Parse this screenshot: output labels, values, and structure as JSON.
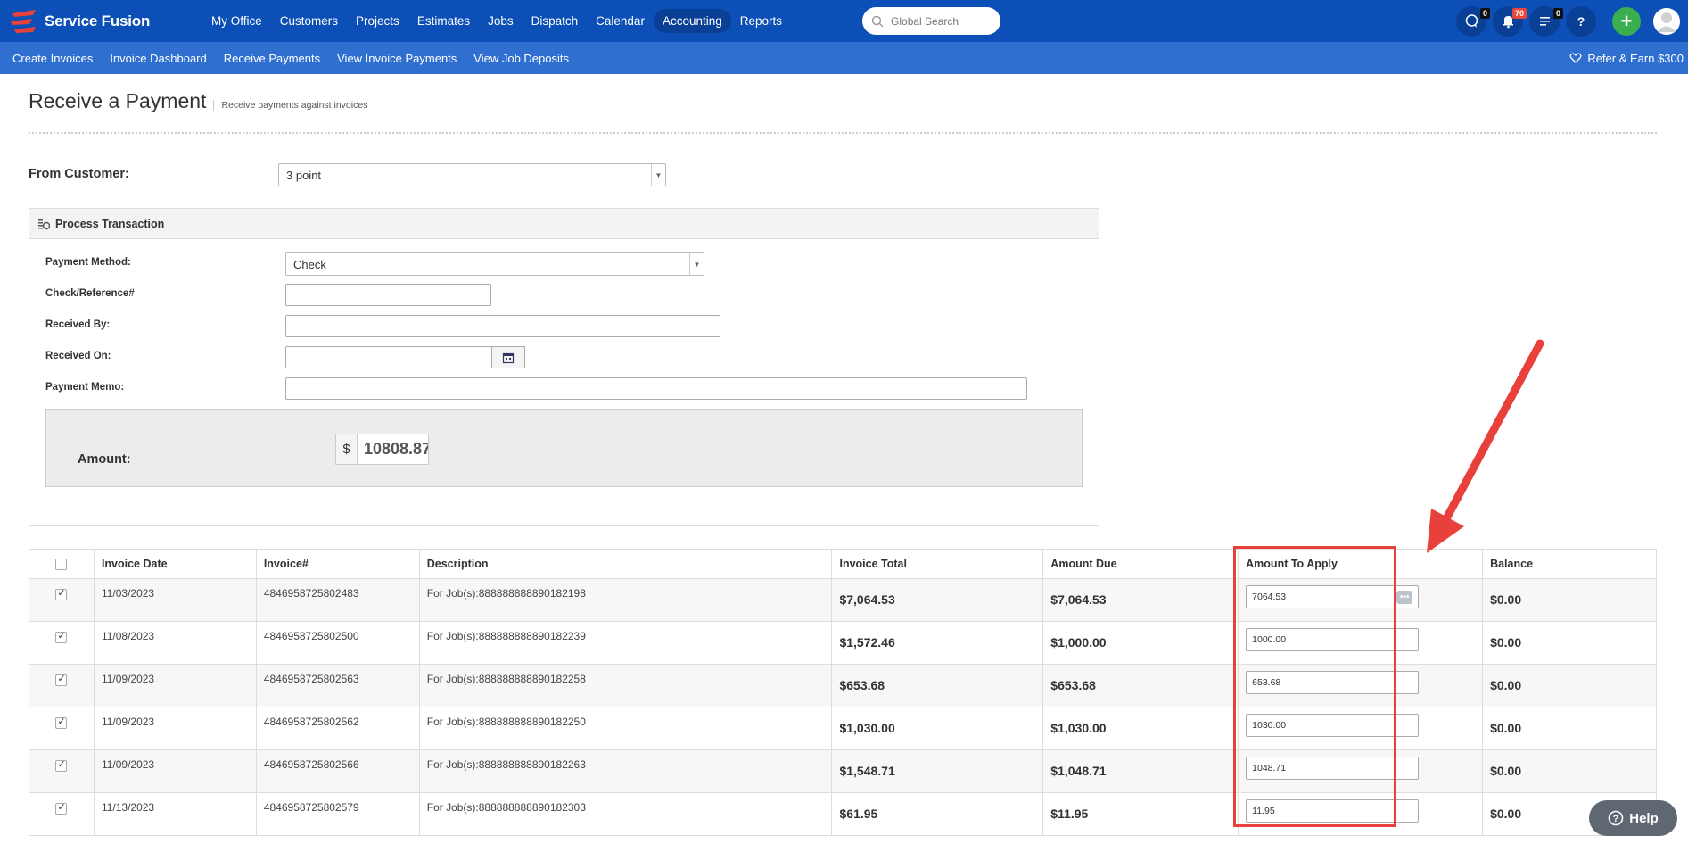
{
  "app": {
    "brand": "Service Fusion"
  },
  "mainnav": [
    {
      "label": "My Office",
      "active": false
    },
    {
      "label": "Customers",
      "active": false
    },
    {
      "label": "Projects",
      "active": false
    },
    {
      "label": "Estimates",
      "active": false
    },
    {
      "label": "Jobs",
      "active": false
    },
    {
      "label": "Dispatch",
      "active": false
    },
    {
      "label": "Calendar",
      "active": false
    },
    {
      "label": "Accounting",
      "active": true
    },
    {
      "label": "Reports",
      "active": false
    }
  ],
  "search": {
    "placeholder": "Global Search"
  },
  "topicons": {
    "chat_count": "0",
    "notif_count": "70",
    "tasks_count": "0",
    "help": "?",
    "plus": "+"
  },
  "subnav": [
    "Create Invoices",
    "Invoice Dashboard",
    "Receive Payments",
    "View Invoice Payments",
    "View Job Deposits"
  ],
  "refer": "Refer & Earn $300",
  "page": {
    "title": "Receive a Payment",
    "subtitle": "Receive payments against invoices"
  },
  "from_customer": {
    "label": "From Customer:",
    "value": "3 point"
  },
  "process": {
    "title": "Process Transaction",
    "payment_method_label": "Payment Method:",
    "payment_method_value": "Check",
    "check_ref_label": "Check/Reference#",
    "received_by_label": "Received By:",
    "received_on_label": "Received On:",
    "memo_label": "Payment Memo:",
    "amount_label": "Amount:",
    "currency": "$",
    "amount_value": "10808.87"
  },
  "table": {
    "headers": [
      "Invoice Date",
      "Invoice#",
      "Description",
      "Invoice Total",
      "Amount Due",
      "Amount To Apply",
      "Balance"
    ],
    "rows": [
      {
        "date": "11/03/2023",
        "invoice": "4846958725802483",
        "desc": "For Job(s):888888888890182198",
        "total": "$7,064.53",
        "due": "$7,064.53",
        "apply": "7064.53",
        "balance": "$0.00"
      },
      {
        "date": "11/08/2023",
        "invoice": "4846958725802500",
        "desc": "For Job(s):888888888890182239",
        "total": "$1,572.46",
        "due": "$1,000.00",
        "apply": "1000.00",
        "balance": "$0.00"
      },
      {
        "date": "11/09/2023",
        "invoice": "4846958725802563",
        "desc": "For Job(s):888888888890182258",
        "total": "$653.68",
        "due": "$653.68",
        "apply": "653.68",
        "balance": "$0.00"
      },
      {
        "date": "11/09/2023",
        "invoice": "4846958725802562",
        "desc": "For Job(s):888888888890182250",
        "total": "$1,030.00",
        "due": "$1,030.00",
        "apply": "1030.00",
        "balance": "$0.00"
      },
      {
        "date": "11/09/2023",
        "invoice": "4846958725802566",
        "desc": "For Job(s):888888888890182263",
        "total": "$1,548.71",
        "due": "$1,048.71",
        "apply": "1048.71",
        "balance": "$0.00"
      },
      {
        "date": "11/13/2023",
        "invoice": "4846958725802579",
        "desc": "For Job(s):888888888890182303",
        "total": "$61.95",
        "due": "$11.95",
        "apply": "11.95",
        "balance": "$0.00"
      }
    ]
  },
  "help": {
    "label": "Help"
  },
  "colors": {
    "nav": "#0c4fb6",
    "subnav": "#2e6fd0",
    "annotation": "#e8403a",
    "plus": "#3aaf4f"
  }
}
